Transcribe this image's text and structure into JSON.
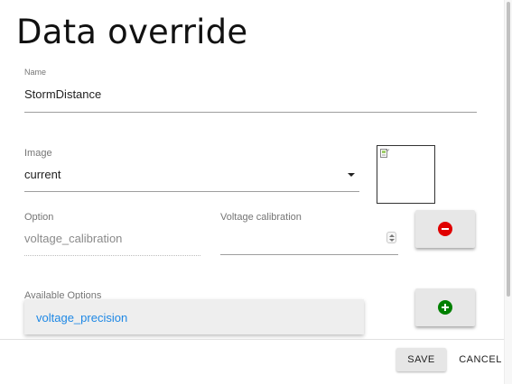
{
  "dialog": {
    "title": "Data override",
    "name_field": {
      "label": "Name",
      "value": "StormDistance"
    },
    "image_field": {
      "label": "Image",
      "value": "current"
    },
    "option_field": {
      "label": "Option",
      "value": "voltage_calibration"
    },
    "voltage_field": {
      "label": "Voltage calibration",
      "value": ""
    },
    "available_options": {
      "label": "Available Options",
      "items": [
        "voltage_precision"
      ]
    },
    "buttons": {
      "save": "SAVE",
      "cancel": "CANCEL"
    },
    "icons": {
      "remove": "minus-circle-icon",
      "add": "plus-circle-icon",
      "image_placeholder": "broken-image-icon"
    },
    "colors": {
      "remove": "#e00000",
      "add": "#008000",
      "option_link": "#1e88e5"
    }
  }
}
